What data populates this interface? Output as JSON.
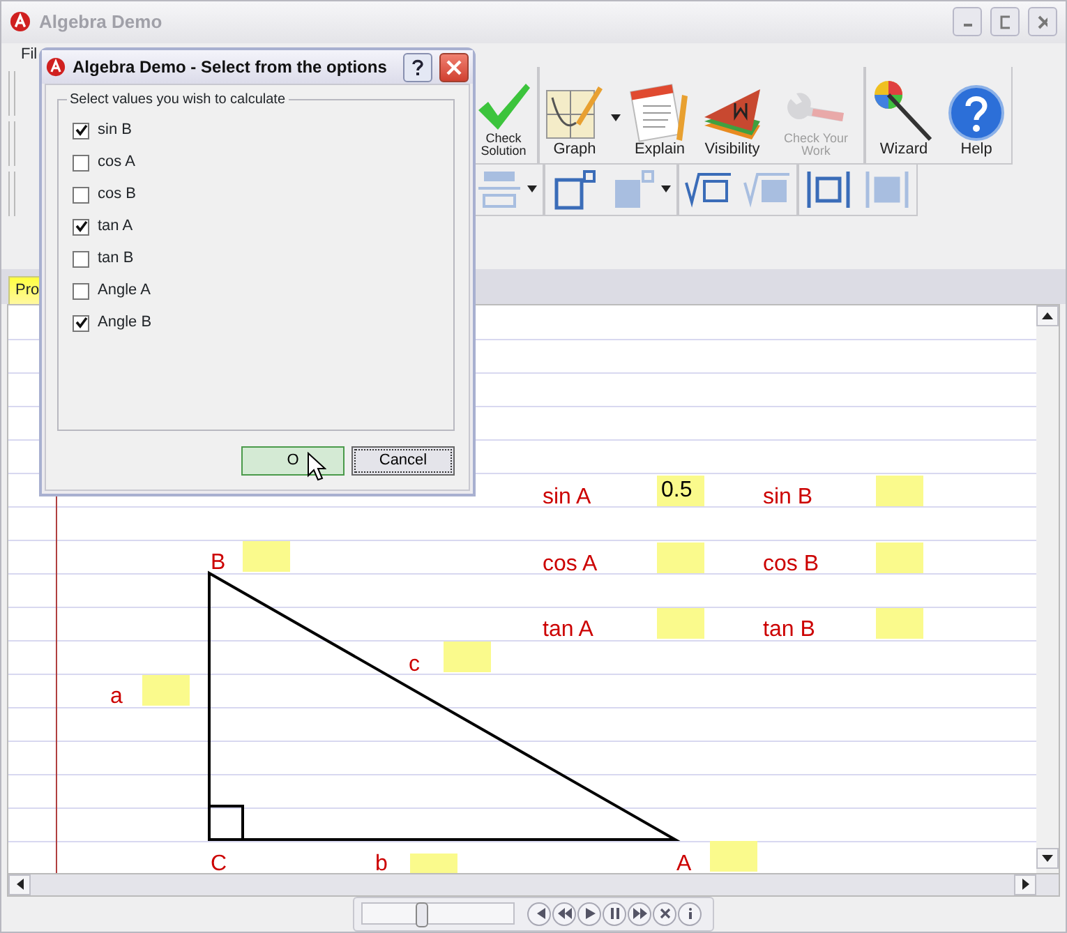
{
  "window": {
    "title": "Algebra Demo"
  },
  "menu": [
    "Fil"
  ],
  "toolbar_row_1": [
    {
      "label": "Check Solution",
      "kind": "check",
      "disabled": false,
      "dropdown": false
    },
    {
      "label": "Graph",
      "kind": "graph",
      "disabled": false,
      "dropdown": true
    },
    {
      "label": "Explain",
      "kind": "explain",
      "disabled": false,
      "dropdown": false
    },
    {
      "label": "Visibility",
      "kind": "visibility",
      "disabled": false,
      "dropdown": false
    },
    {
      "label": "Check Your Work",
      "kind": "wrench",
      "disabled": true,
      "dropdown": false
    },
    {
      "label": "Wizard",
      "kind": "wizard",
      "disabled": false,
      "dropdown": false
    },
    {
      "label": "Help",
      "kind": "help",
      "disabled": false,
      "dropdown": false
    }
  ],
  "toolbar_row_2": [
    {
      "kind": "align",
      "disabled": false,
      "dropdown": true
    },
    {
      "kind": "superscript",
      "disabled": false,
      "dropdown": false
    },
    {
      "kind": "superscript",
      "disabled": true,
      "dropdown": true
    },
    {
      "kind": "root",
      "disabled": false,
      "dropdown": false
    },
    {
      "kind": "root",
      "disabled": true,
      "dropdown": false
    },
    {
      "kind": "abs",
      "disabled": false,
      "dropdown": false
    },
    {
      "kind": "abs",
      "disabled": true,
      "dropdown": false
    }
  ],
  "tabs": [
    {
      "label": "Pro",
      "selected": true
    }
  ],
  "worksheet": {
    "ratios": [
      {
        "label": "sin A",
        "value": "0.5"
      },
      {
        "label": "sin B"
      },
      {
        "label": "cos A"
      },
      {
        "label": "cos B"
      },
      {
        "label": "tan A"
      },
      {
        "label": "tan B"
      }
    ],
    "vertices": [
      "B",
      "C",
      "A"
    ],
    "sides": [
      {
        "label": "c"
      },
      {
        "label": "a"
      },
      {
        "label": "b"
      }
    ]
  },
  "dialog": {
    "title": "Algebra Demo - Select from the options",
    "group_label": "Select values you wish to calculate",
    "options": [
      {
        "label": "sin B",
        "checked": true
      },
      {
        "label": "cos A",
        "checked": false
      },
      {
        "label": "cos B",
        "checked": false
      },
      {
        "label": "tan A",
        "checked": true
      },
      {
        "label": "tan B",
        "checked": false
      },
      {
        "label": "Angle A",
        "checked": false
      },
      {
        "label": "Angle B",
        "checked": true
      }
    ],
    "buttons": [
      {
        "label": "O",
        "kind": "default"
      },
      {
        "label": "Cancel",
        "kind": "focused"
      }
    ]
  },
  "player": {
    "level": 0.38,
    "buttons": [
      {
        "kind": "first"
      },
      {
        "kind": "rewind"
      },
      {
        "kind": "play"
      },
      {
        "kind": "pause"
      },
      {
        "kind": "forward"
      },
      {
        "kind": "stop"
      },
      {
        "kind": "info"
      }
    ]
  }
}
